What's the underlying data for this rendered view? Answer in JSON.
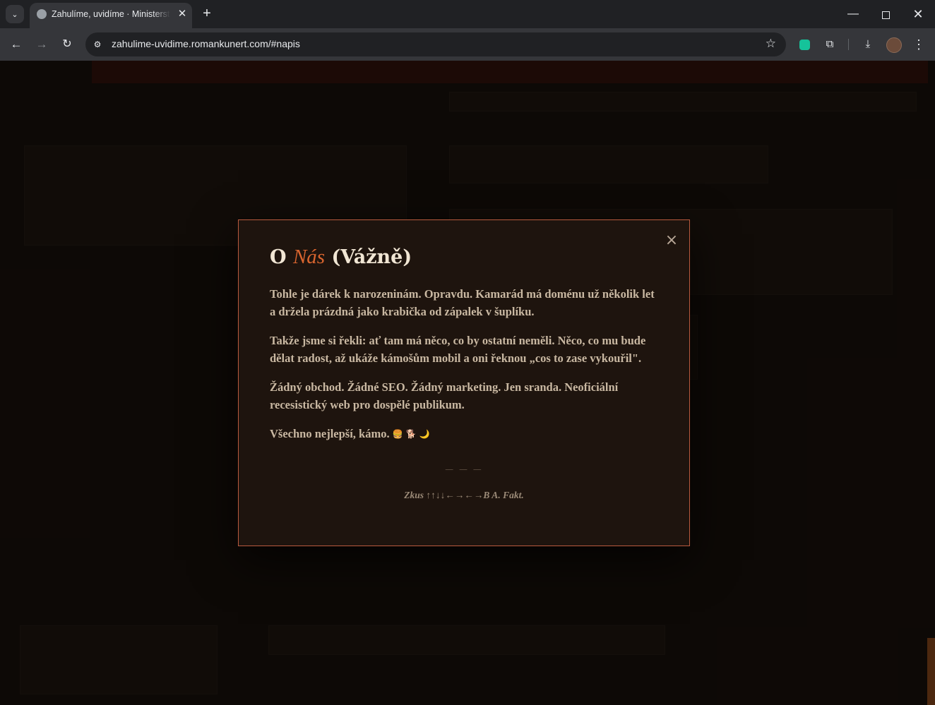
{
  "browser": {
    "tab": {
      "title": "Zahulíme, uvidíme · Ministerstvo"
    },
    "icons": {
      "tab_list": "chevron-down-icon",
      "tab_close": "close-icon",
      "new_tab": "plus-icon",
      "back": "arrow-left-icon",
      "forward": "arrow-right-icon",
      "reload": "reload-icon",
      "site_info": "tune-icon",
      "bookmark": "star-icon",
      "extensions": "puzzle-icon",
      "downloads": "download-icon",
      "menu": "kebab-menu-icon"
    },
    "address_bar": {
      "url": "zahulime-uvidime.romankunert.com/#napis"
    },
    "glyphs": {
      "tab_list": "⌄",
      "tab_close": "✕",
      "new_tab": "+",
      "back": "←",
      "forward": "→",
      "reload": "↻",
      "site_info": "⚙",
      "bookmark": "☆",
      "extensions": "⧉",
      "downloads": "⤓",
      "menu": "⋮",
      "minimize": "—",
      "close_window": "✕"
    }
  },
  "modal": {
    "close_glyph": "×",
    "title": {
      "prefix": "O",
      "accent": "Nás",
      "suffix": "(Vážně)"
    },
    "paragraphs": [
      "Tohle je dárek k narozeninám. Opravdu. Kamarád má doménu už několik let a držela prázdná jako krabička od zápalek v šuplíku.",
      "Takže jsme si řekli: ať tam má něco, co by ostatní neměli. Něco, co mu bude dělat radost, až ukáže kámošům mobil a oni řeknou „cos to zase vykouřil\".",
      "Žádný obchod. Žádné SEO. Žádný marketing. Jen sranda. Neoficiální recesistický web pro dospělé publikum.",
      "Všechno nejlepší, kámo."
    ],
    "closing_emojis": {
      "burger": "🍔",
      "dog": "🐕",
      "moon": "🌙"
    },
    "divider": "— — —",
    "signature": "Zkus ↑↑↓↓←→←→B A. Fakt.",
    "colors": {
      "accent": "#d9652f",
      "border": "#b85a3e",
      "background": "#1e140e"
    }
  }
}
